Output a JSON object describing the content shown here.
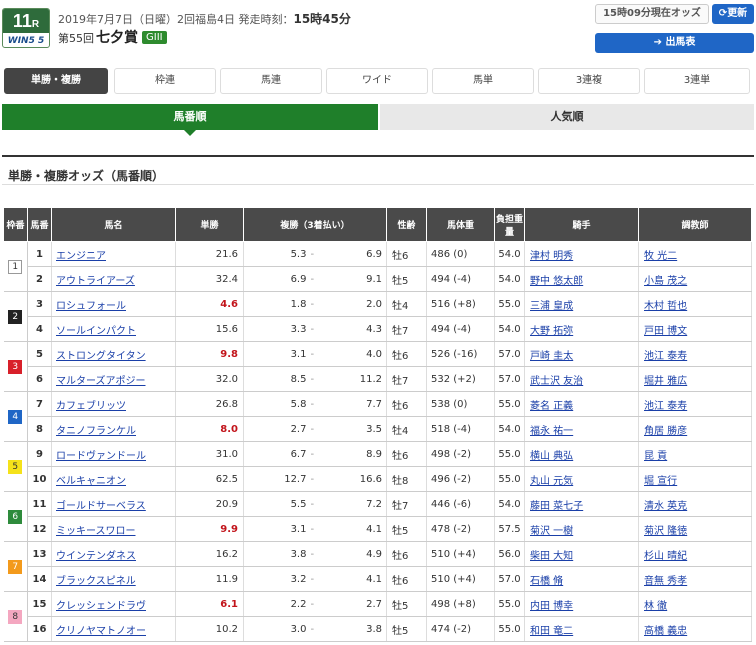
{
  "race": {
    "num": "11",
    "suffix": "R",
    "logo": "WIN5 5",
    "meta": "2019年7月7日（日曜）2回福島4日 発走時刻：",
    "post_time": "15時45分",
    "edition": "第55回",
    "name": "七夕賞",
    "grade": "GIII"
  },
  "controls": {
    "odds_time": "15時09分現在オッズ",
    "update_label": "更新",
    "entries_label": "出馬表"
  },
  "bet_tabs": [
    "単勝・複勝",
    "枠連",
    "馬連",
    "ワイド",
    "馬単",
    "3連複",
    "3連単"
  ],
  "sort_tabs": {
    "by_number": "馬番順",
    "by_popularity": "人気順"
  },
  "section_title": "単勝・複勝オッズ（馬番順）",
  "colors": {
    "accent_green": "#1f7f2a",
    "blue": "#1f66c6",
    "hot": "#c2141b"
  },
  "table": {
    "headers": {
      "waku": "枠番",
      "uma": "馬番",
      "name": "馬名",
      "win": "単勝",
      "place": "複勝（3着払い）",
      "sex": "性齢",
      "weight": "馬体重",
      "kin": "負担重量",
      "jockey": "騎手",
      "trainer": "調教師"
    },
    "frame_colors": [
      "#ffffff",
      "#222222",
      "#d8202a",
      "#1f66c6",
      "#f5e21a",
      "#2e8b3c",
      "#f39a1c",
      "#f4a7c0"
    ],
    "rows": [
      {
        "waku": "1",
        "uma": "1",
        "name": "エンジニア",
        "win": "21.6",
        "hot": false,
        "p1": "5.3",
        "p2": "6.9",
        "sex": "牡6",
        "wt": "486 (0)",
        "kin": "54.0",
        "jockey": "津村 明秀",
        "trainer": "牧 光二"
      },
      {
        "waku": "",
        "uma": "2",
        "name": "アウトライアーズ",
        "win": "32.4",
        "hot": false,
        "p1": "6.9",
        "p2": "9.1",
        "sex": "牡5",
        "wt": "494 (-4)",
        "kin": "54.0",
        "jockey": "野中 悠太郎",
        "trainer": "小島 茂之"
      },
      {
        "waku": "2",
        "uma": "3",
        "name": "ロシュフォール",
        "win": "4.6",
        "hot": true,
        "p1": "1.8",
        "p2": "2.0",
        "sex": "牡4",
        "wt": "516 (+8)",
        "kin": "55.0",
        "jockey": "三浦 皇成",
        "trainer": "木村 哲也"
      },
      {
        "waku": "",
        "uma": "4",
        "name": "ソールインパクト",
        "win": "15.6",
        "hot": false,
        "p1": "3.3",
        "p2": "4.3",
        "sex": "牡7",
        "wt": "494 (-4)",
        "kin": "54.0",
        "jockey": "大野 拓弥",
        "trainer": "戸田 博文"
      },
      {
        "waku": "3",
        "uma": "5",
        "name": "ストロングタイタン",
        "win": "9.8",
        "hot": true,
        "p1": "3.1",
        "p2": "4.0",
        "sex": "牡6",
        "wt": "526 (-16)",
        "kin": "57.0",
        "jockey": "戸崎 圭太",
        "trainer": "池江 泰寿"
      },
      {
        "waku": "",
        "uma": "6",
        "name": "マルターズアポジー",
        "win": "32.0",
        "hot": false,
        "p1": "8.5",
        "p2": "11.2",
        "sex": "牡7",
        "wt": "532 (+2)",
        "kin": "57.0",
        "jockey": "武士沢 友治",
        "trainer": "堀井 雅広"
      },
      {
        "waku": "4",
        "uma": "7",
        "name": "カフェブリッツ",
        "win": "26.8",
        "hot": false,
        "p1": "5.8",
        "p2": "7.7",
        "sex": "牡6",
        "wt": "538 (0)",
        "kin": "55.0",
        "jockey": "菱名 正義",
        "trainer": "池江 泰寿"
      },
      {
        "waku": "",
        "uma": "8",
        "name": "タニノフランケル",
        "win": "8.0",
        "hot": true,
        "p1": "2.7",
        "p2": "3.5",
        "sex": "牡4",
        "wt": "518 (-4)",
        "kin": "54.0",
        "jockey": "福永 祐一",
        "trainer": "角居 勝彦"
      },
      {
        "waku": "5",
        "uma": "9",
        "name": "ロードヴァンドール",
        "win": "31.0",
        "hot": false,
        "p1": "6.7",
        "p2": "8.9",
        "sex": "牡6",
        "wt": "498 (-2)",
        "kin": "55.0",
        "jockey": "横山 典弘",
        "trainer": "昆 貢"
      },
      {
        "waku": "",
        "uma": "10",
        "name": "ベルキャニオン",
        "win": "62.5",
        "hot": false,
        "p1": "12.7",
        "p2": "16.6",
        "sex": "牡8",
        "wt": "496 (-2)",
        "kin": "55.0",
        "jockey": "丸山 元気",
        "trainer": "堀 宣行"
      },
      {
        "waku": "6",
        "uma": "11",
        "name": "ゴールドサーベラス",
        "win": "20.9",
        "hot": false,
        "p1": "5.5",
        "p2": "7.2",
        "sex": "牡7",
        "wt": "446 (-6)",
        "kin": "54.0",
        "jockey": "藤田 菜七子",
        "trainer": "清水 英克"
      },
      {
        "waku": "",
        "uma": "12",
        "name": "ミッキースワロー",
        "win": "9.9",
        "hot": true,
        "p1": "3.1",
        "p2": "4.1",
        "sex": "牡5",
        "wt": "478 (-2)",
        "kin": "57.5",
        "jockey": "菊沢 一樹",
        "trainer": "菊沢 隆徳"
      },
      {
        "waku": "7",
        "uma": "13",
        "name": "ウインテンダネス",
        "win": "16.2",
        "hot": false,
        "p1": "3.8",
        "p2": "4.9",
        "sex": "牡6",
        "wt": "510 (+4)",
        "kin": "56.0",
        "jockey": "柴田 大知",
        "trainer": "杉山 晴紀"
      },
      {
        "waku": "",
        "uma": "14",
        "name": "ブラックスピネル",
        "win": "11.9",
        "hot": false,
        "p1": "3.2",
        "p2": "4.1",
        "sex": "牡6",
        "wt": "510 (+4)",
        "kin": "57.0",
        "jockey": "石橋 脩",
        "trainer": "音無 秀孝"
      },
      {
        "waku": "8",
        "uma": "15",
        "name": "クレッシェンドラヴ",
        "win": "6.1",
        "hot": true,
        "p1": "2.2",
        "p2": "2.7",
        "sex": "牡5",
        "wt": "498 (+8)",
        "kin": "55.0",
        "jockey": "内田 博幸",
        "trainer": "林 徹"
      },
      {
        "waku": "",
        "uma": "16",
        "name": "クリノヤマトノオー",
        "win": "10.2",
        "hot": false,
        "p1": "3.0",
        "p2": "3.8",
        "sex": "牡5",
        "wt": "474 (-2)",
        "kin": "55.0",
        "jockey": "和田 竜二",
        "trainer": "高橋 義忠"
      }
    ]
  }
}
